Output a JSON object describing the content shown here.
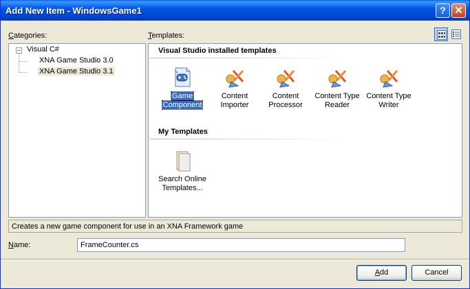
{
  "window": {
    "title": "Add New Item - WindowsGame1",
    "help_glyph": "?",
    "close_glyph": "✕"
  },
  "labels": {
    "categories_prefix": "",
    "categories_u": "C",
    "categories_rest": "ategories:",
    "templates_u": "T",
    "templates_rest": "emplates:",
    "name_u": "N",
    "name_rest": "ame:"
  },
  "categories": {
    "expander": "−",
    "root": "Visual C#",
    "children": [
      "XNA Game Studio 3.0",
      "XNA Game Studio 3.1"
    ],
    "selected": "XNA Game Studio 3.1"
  },
  "templates": {
    "groups": [
      {
        "header": "Visual Studio installed templates",
        "items": [
          {
            "line1": "Game",
            "line2": "Component",
            "icon": "game-component-icon",
            "selected": true
          },
          {
            "line1": "Content",
            "line2": "Importer",
            "icon": "content-importer-icon"
          },
          {
            "line1": "Content",
            "line2": "Processor",
            "icon": "content-processor-icon"
          },
          {
            "line1": "Content Type",
            "line2": "Reader",
            "icon": "content-type-reader-icon"
          },
          {
            "line1": "Content Type",
            "line2": "Writer",
            "icon": "content-type-writer-icon"
          }
        ]
      },
      {
        "header": "My Templates",
        "items": [
          {
            "line1": "Search Online",
            "line2": "Templates...",
            "icon": "search-online-templates-icon"
          }
        ]
      }
    ]
  },
  "description": "Creates a new game component for use in an XNA Framework game",
  "name_field": {
    "value": "FrameCounter.cs"
  },
  "buttons": {
    "add_u": "A",
    "add_rest": "dd",
    "cancel": "Cancel"
  },
  "colors": {
    "title_bar": "#0058e6",
    "selection": "#316ac5",
    "dialog_bg": "#ece9d8",
    "border": "#7f9db9"
  }
}
